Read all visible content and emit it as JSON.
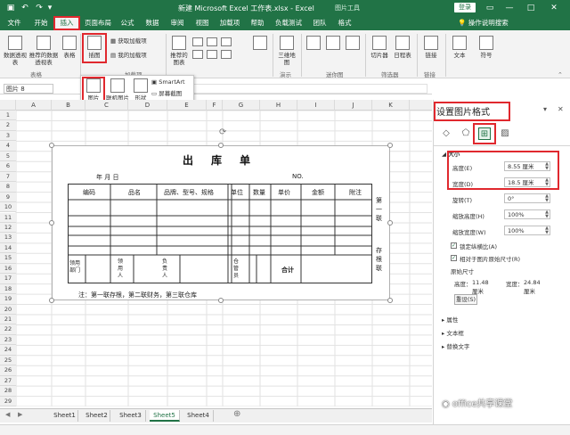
{
  "window": {
    "doc_title": "新建 Microsoft Excel 工作表.xlsx  -  Excel",
    "context_tab_title": "图片工具",
    "login_label": "登录"
  },
  "tabs": [
    "文件",
    "开始",
    "插入",
    "页面布局",
    "公式",
    "数据",
    "审阅",
    "视图",
    "加载项",
    "帮助",
    "负载测试",
    "团队",
    "格式"
  ],
  "active_tab": "插入",
  "tell_me": "操作说明搜索",
  "ribbon": {
    "pivot": "数据透视表",
    "recommended_pivot": "推荐的数据透视表",
    "table": "表格",
    "illustrations": "插图",
    "get_addins": "获取加载项",
    "my_addins": "我的加载项",
    "addins_group": "加载项",
    "recommended_charts": "推荐的图表",
    "maps_3d": "三维地图",
    "tours_group": "演示",
    "sparkline_group": "迷你图",
    "slicer": "切片器",
    "timeline": "日程表",
    "filter_group": "筛选器",
    "link": "链接",
    "links_group": "链接",
    "text": "文本",
    "symbol": "符号",
    "tables_group": "表格",
    "popup": {
      "picture": "图片",
      "online_picture": "联机图片",
      "shapes": "形状",
      "smartart": "SmartArt",
      "screenshot": "屏幕截图",
      "group": "插图"
    }
  },
  "namebox": "图片 8",
  "fx": "fx",
  "columns": [
    "A",
    "B",
    "C",
    "D",
    "E",
    "F",
    "G",
    "H",
    "I",
    "J",
    "K"
  ],
  "rows": [
    "1",
    "2",
    "3",
    "4",
    "5",
    "6",
    "7",
    "8",
    "9",
    "10",
    "11",
    "12",
    "13",
    "14",
    "15",
    "16",
    "17",
    "18",
    "19",
    "20",
    "21",
    "22",
    "23",
    "24",
    "25",
    "26",
    "27",
    "28",
    "29"
  ],
  "form": {
    "title": "出库单",
    "date": "年     月     日",
    "no_label": "NO.",
    "headers": [
      "编码",
      "品名",
      "品牌、型号、规格",
      "单位",
      "数量",
      "单价",
      "金额",
      "附注"
    ],
    "side_first": "第一联",
    "side_stub": "存根联",
    "footer_cells": [
      "领用部门",
      "领用人",
      "负责人",
      "仓管员",
      "合计"
    ],
    "note": "注：第一联存根，第二联财务，第三联仓库"
  },
  "sheets": [
    "Sheet1",
    "Sheet2",
    "Sheet3",
    "Sheet5",
    "Sheet4"
  ],
  "active_sheet": "Sheet5",
  "pane": {
    "title": "设置图片格式",
    "size_section": "大小",
    "height_label": "高度(E)",
    "height_value": "8.55 厘米",
    "width_label": "宽度(D)",
    "width_value": "18.5 厘米",
    "rotation_label": "旋转(T)",
    "rotation_value": "0°",
    "scale_h_label": "缩放高度(H)",
    "scale_h_value": "100%",
    "scale_w_label": "缩放宽度(W)",
    "scale_w_value": "100%",
    "lock_ratio": "锁定纵横比(A)",
    "relative_original": "相对于图片原始尺寸(R)",
    "original_size": "原始尺寸",
    "orig_height_label": "高度：",
    "orig_height_value": "11.48 厘米",
    "orig_width_label": "宽度：",
    "orig_width_value": "24.84 厘米",
    "reset": "重设(S)",
    "properties": "属性",
    "textbox": "文本框",
    "alt_text": "替换文字"
  },
  "watermark": "office共享课堂",
  "colors": {
    "excel_green": "#217346",
    "highlight_red": "#e0282e"
  }
}
